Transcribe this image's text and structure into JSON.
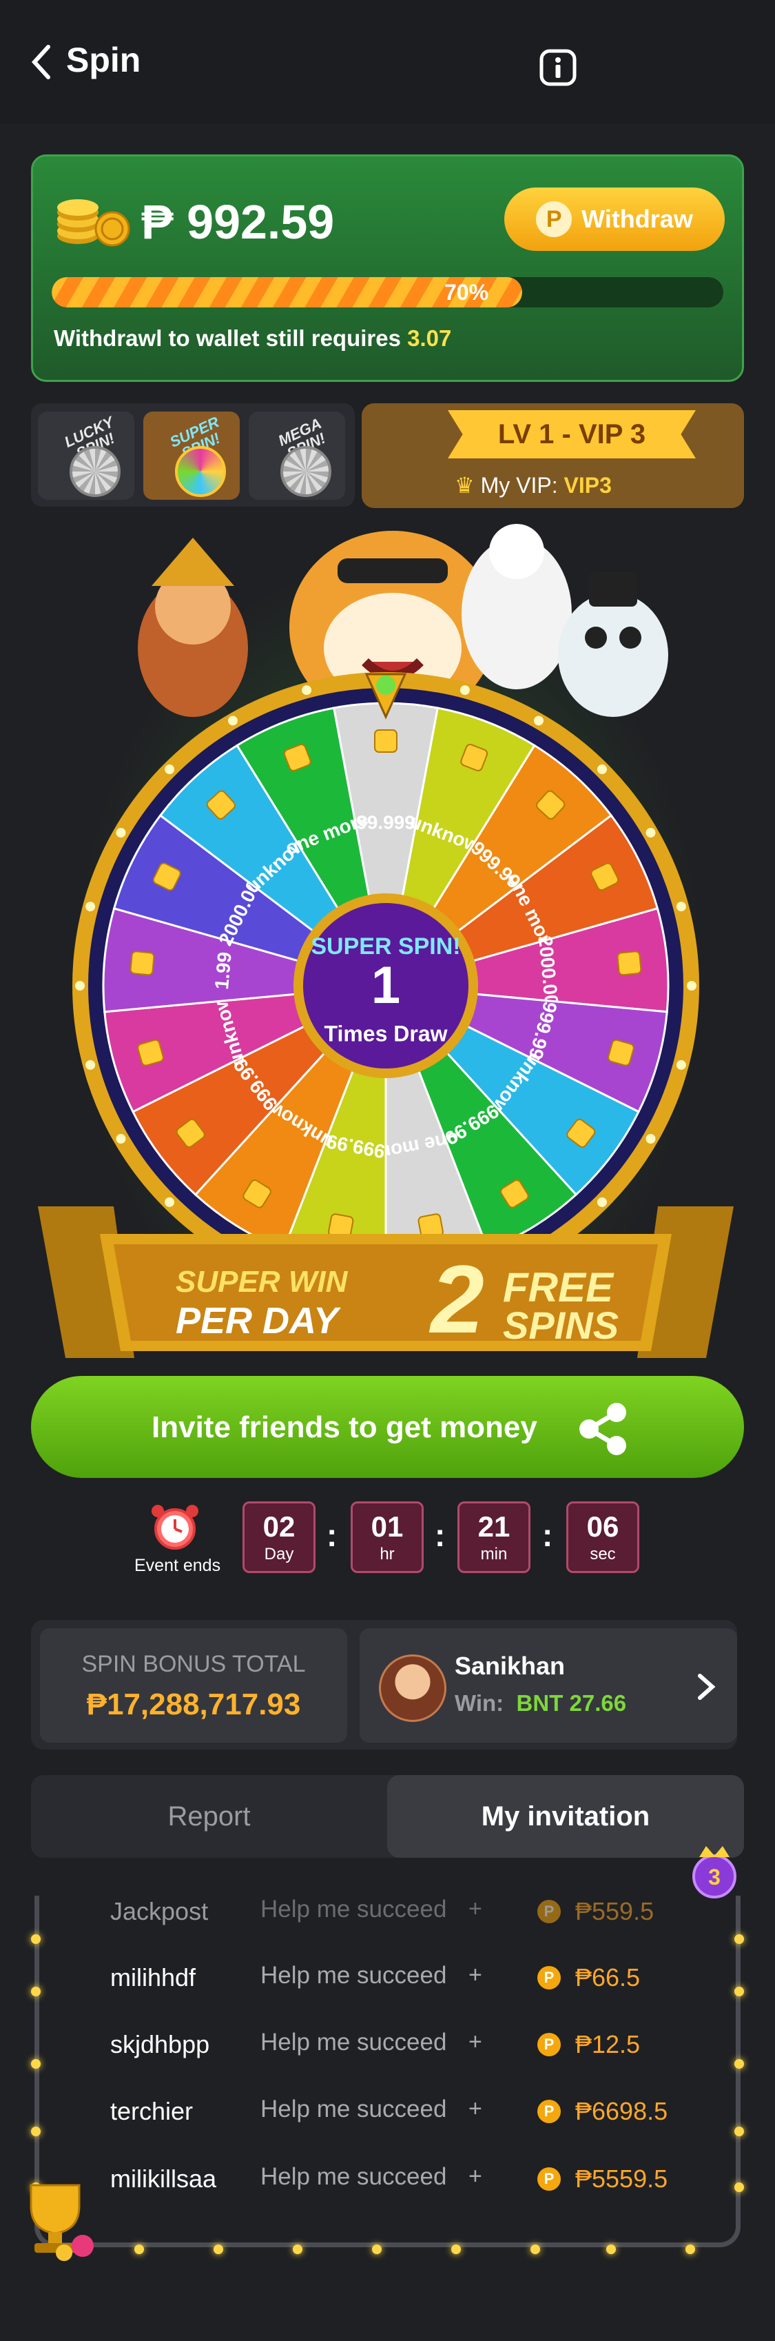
{
  "header": {
    "title": "Spin"
  },
  "balance": {
    "amount": "₱ 992.59",
    "withdraw_label": "Withdraw",
    "coin_symbol": "P",
    "progress_pct": 70,
    "progress_label": "70%",
    "note_prefix": "Withdrawl to wallet still requires",
    "note_value": "3.07"
  },
  "spin_types": [
    {
      "label": "LUCKY SPIN!",
      "selected": false
    },
    {
      "label": "SUPER SPIN!",
      "selected": true
    },
    {
      "label": "MEGA SPIN!",
      "selected": false
    }
  ],
  "vip": {
    "level": "LV 1 - VIP 3",
    "my_vip_label": "My VIP:",
    "my_vip_value": "VIP3"
  },
  "wheel": {
    "center_title": "SUPER SPIN!",
    "center_count": "1",
    "center_sub": "Times Draw",
    "segments": [
      "99.999",
      "unknow",
      "999.99",
      "one more",
      "2000.00",
      "999.99",
      "unknow",
      "999.99",
      "one more",
      "999.99",
      "unknow",
      "999.99",
      "unknow",
      "1.99",
      "2000.00",
      "unknow",
      "one more"
    ],
    "colors": [
      "#d8d8d8",
      "#c7d41a",
      "#f08a12",
      "#e8601a",
      "#d83aa0",
      "#a745d0",
      "#2ab8e8",
      "#1cb83a",
      "#d8d8d8",
      "#c7d41a",
      "#f08a12",
      "#e8601a",
      "#d83aa0",
      "#a745d0",
      "#5a4ad8",
      "#2ab8e8",
      "#1cb83a"
    ]
  },
  "promo": {
    "line1": "SUPER WIN",
    "line2": "PER DAY",
    "number": "2",
    "free1": "FREE",
    "free2": "SPINS"
  },
  "invite": {
    "label": "Invite friends to get money"
  },
  "countdown": {
    "label": "Event ends",
    "units": [
      {
        "value": "02",
        "unit": "Day"
      },
      {
        "value": "01",
        "unit": "hr"
      },
      {
        "value": "21",
        "unit": "min"
      },
      {
        "value": "06",
        "unit": "sec"
      }
    ]
  },
  "bonus": {
    "title": "SPIN BONUS TOTAL",
    "value": "₱17,288,717.93",
    "winner_name": "Sanikhan",
    "winner_label": "Win:",
    "winner_amount": "BNT 27.66"
  },
  "report_tabs": {
    "tab1": "Report",
    "tab2": "My invitation",
    "active": "tab2"
  },
  "rows": [
    {
      "name": "Jackpost",
      "help": "Help me succeed",
      "plus": "+",
      "amount": "₱559.5"
    },
    {
      "name": "milihhdf",
      "help": "Help me succeed",
      "plus": "+",
      "amount": "₱66.5"
    },
    {
      "name": "skjdhbpp",
      "help": "Help me succeed",
      "plus": "+",
      "amount": "₱12.5"
    },
    {
      "name": "terchier",
      "help": "Help me succeed",
      "plus": "+",
      "amount": "₱6698.5"
    },
    {
      "name": "milikillsaa",
      "help": "Help me succeed",
      "plus": "+",
      "amount": "₱5559.5"
    }
  ]
}
